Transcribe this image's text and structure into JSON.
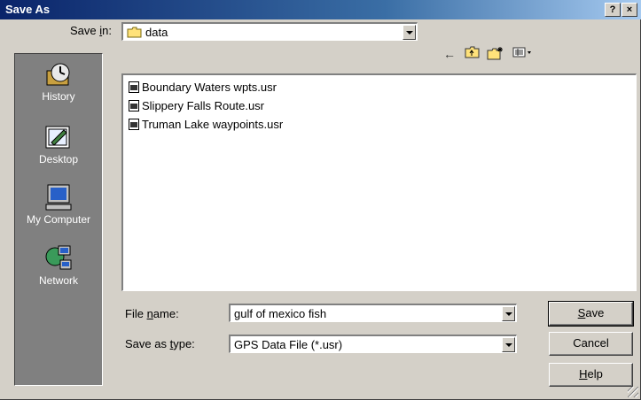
{
  "window": {
    "title": "Save As",
    "help_btn": "?",
    "close_btn": "×"
  },
  "save_in": {
    "label_pre": "Save ",
    "label_u": "i",
    "label_post": "n:",
    "value": "data"
  },
  "toolbar": {
    "back": "←",
    "up": "up-folder",
    "new_folder": "new-folder",
    "views": "view-menu"
  },
  "places": [
    {
      "label": "History",
      "icon": "history-icon"
    },
    {
      "label": "Desktop",
      "icon": "desktop-icon"
    },
    {
      "label": "My Computer",
      "icon": "my-computer-icon"
    },
    {
      "label": "Network",
      "icon": "network-icon"
    }
  ],
  "files": [
    {
      "name": "Boundary Waters wpts.usr"
    },
    {
      "name": "Slippery Falls Route.usr"
    },
    {
      "name": "Truman Lake waypoints.usr"
    }
  ],
  "file_name": {
    "label_pre": "File ",
    "label_u": "n",
    "label_post": "ame:",
    "value": "gulf of mexico fish"
  },
  "save_type": {
    "label_pre": "Save as ",
    "label_u": "t",
    "label_post": "ype:",
    "value": "GPS Data File (*.usr)"
  },
  "buttons": {
    "save_u": "S",
    "save_rest": "ave",
    "cancel": "Cancel",
    "help_u": "H",
    "help_rest": "elp"
  }
}
